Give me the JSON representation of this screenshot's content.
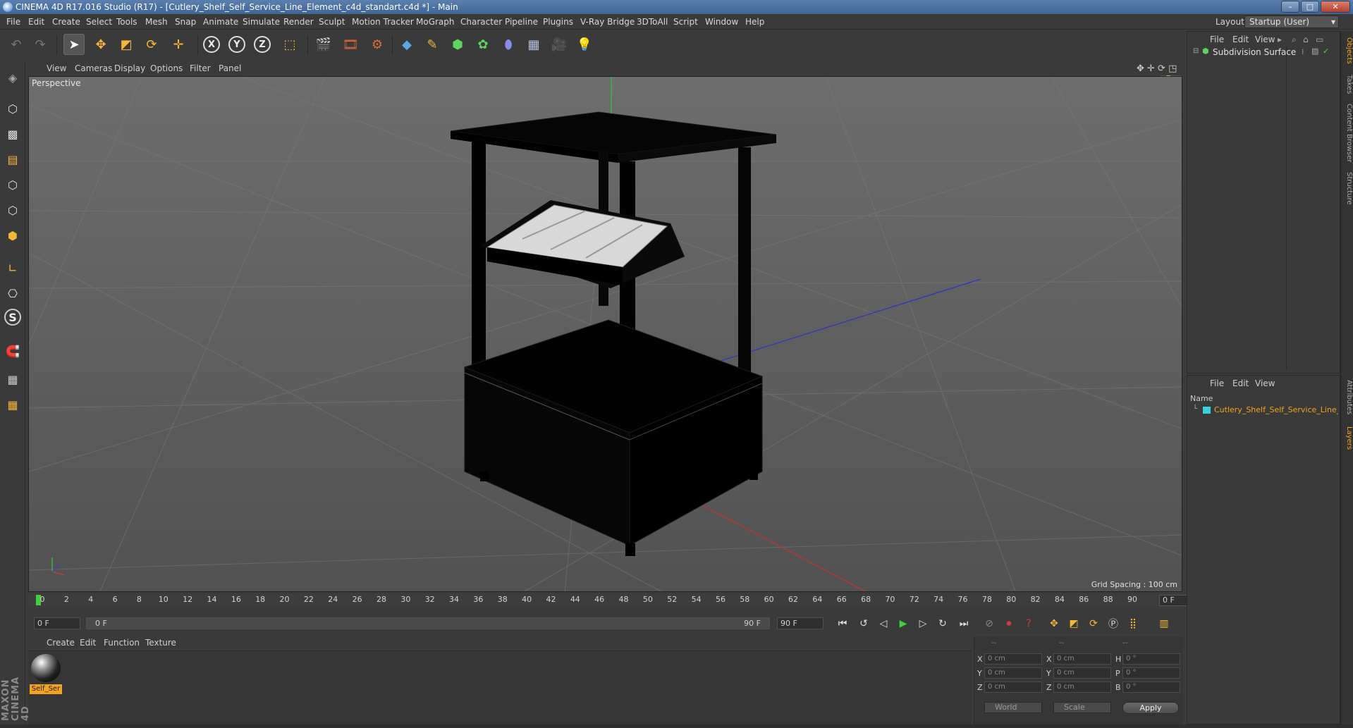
{
  "window": {
    "title": "CINEMA 4D R17.016 Studio (R17) - [Cutlery_Shelf_Self_Service_Line_Element_c4d_standart.c4d *] - Main",
    "controls": [
      "–",
      "□",
      "✕"
    ]
  },
  "menubar": {
    "items": [
      "File",
      "Edit",
      "Create",
      "Select",
      "Tools",
      "Mesh",
      "Snap",
      "Animate",
      "Simulate",
      "Render",
      "Sculpt",
      "Motion Tracker",
      "MoGraph",
      "Character",
      "Pipeline",
      "Plugins",
      "V-Ray Bridge",
      "3DToAll",
      "Script",
      "Window",
      "Help"
    ],
    "layout_label": "Layout:",
    "layout_value": "Startup (User)"
  },
  "toolbar": {
    "axis_x": "X",
    "axis_y": "Y",
    "axis_z": "Z"
  },
  "viewport": {
    "menu": [
      "View",
      "Cameras",
      "Display",
      "Options",
      "Filter",
      "Panel"
    ],
    "camera_label": "Perspective",
    "grid_spacing": "Grid Spacing : 100 cm"
  },
  "timeline": {
    "ticks": [
      "0",
      "2",
      "4",
      "6",
      "8",
      "10",
      "12",
      "14",
      "16",
      "18",
      "20",
      "22",
      "24",
      "26",
      "28",
      "30",
      "32",
      "34",
      "36",
      "38",
      "40",
      "42",
      "44",
      "46",
      "48",
      "50",
      "52",
      "54",
      "56",
      "58",
      "60",
      "62",
      "64",
      "66",
      "68",
      "70",
      "72",
      "74",
      "76",
      "78",
      "80",
      "82",
      "84",
      "86",
      "88",
      "90"
    ],
    "current_frame": "0 F"
  },
  "transport": {
    "start_field": "0 F",
    "range_start": "0 F",
    "range_end": "90 F",
    "end_field": "90 F"
  },
  "material_manager": {
    "menu": [
      "Create",
      "Edit",
      "Function",
      "Texture"
    ],
    "material_name": "Self_Ser"
  },
  "coordinates": {
    "header": [
      "--",
      "--",
      "--"
    ],
    "rows": [
      {
        "l1": "X",
        "v1": "0 cm",
        "l2": "X",
        "v2": "0 cm",
        "l3": "H",
        "v3": "0 °"
      },
      {
        "l1": "Y",
        "v1": "0 cm",
        "l2": "Y",
        "v2": "0 cm",
        "l3": "P",
        "v3": "0 °"
      },
      {
        "l1": "Z",
        "v1": "0 cm",
        "l2": "Z",
        "v2": "0 cm",
        "l3": "B",
        "v3": "0 °"
      }
    ],
    "mode_world": "World",
    "mode_scale": "Scale",
    "apply": "Apply"
  },
  "object_manager": {
    "menu": [
      "File",
      "Edit",
      "View"
    ],
    "objects": [
      {
        "name": "Subdivision Surface"
      }
    ]
  },
  "layer_manager": {
    "menu": [
      "File",
      "Edit",
      "View"
    ],
    "column_name": "Name",
    "layers": [
      {
        "name": "Cutlery_Shelf_Self_Service_Line_El"
      }
    ]
  },
  "right_tabs": [
    "Objects",
    "Takes",
    "Content Browser",
    "Structure",
    "Attributes",
    "Layers"
  ],
  "brand": "MAXON CINEMA 4D",
  "colors": {
    "accent": "#f2a31c",
    "play_green": "#3fcf3f",
    "record_red": "#d33a3a",
    "layer_cyan": "#35d3e0"
  }
}
